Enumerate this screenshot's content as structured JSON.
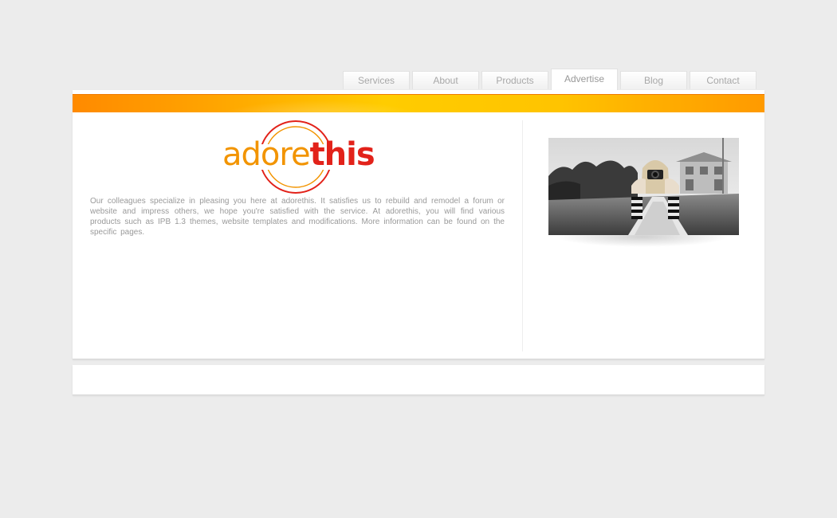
{
  "nav": {
    "tabs": [
      {
        "label": "Services"
      },
      {
        "label": "About"
      },
      {
        "label": "Products"
      },
      {
        "label": "Advertise"
      },
      {
        "label": "Blog"
      },
      {
        "label": "Contact"
      }
    ],
    "active_index": 3
  },
  "logo": {
    "part1": "adore",
    "part2": "this",
    "colors": {
      "adore": "#f29400",
      "this": "#e2221a",
      "ring": "#e2221a"
    }
  },
  "content": {
    "intro": "Our colleagues specialize in pleasing you here at adorethis. It satisfies us to rebuild and remodel a forum or website and impress others, we hope you're satisfied with the service. At adorethis, you will find various products such as IPB 1.3 themes, website templates and modifications. More information can be found on the specific pages."
  },
  "theme": {
    "banner_colors": [
      "#ff8a00",
      "#ffcc00"
    ],
    "background": "#ececec"
  }
}
